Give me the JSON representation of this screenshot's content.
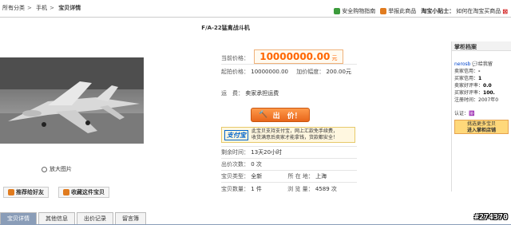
{
  "breadcrumb": [
    "所有分类",
    "手机",
    "宝贝详情"
  ],
  "header": {
    "safety_label": "安全购物指南",
    "report_label": "举报此商品",
    "tip_label": "淘宝小贴士：",
    "tip_link": "如何在淘宝买商品"
  },
  "item": {
    "title": "F/A-22猛禽战斗机",
    "current_price_label": "当前价格：",
    "current_price": "10000000.00",
    "price_unit": "元",
    "start_price_label": "起拍价格：",
    "start_price": "10000000.00",
    "increment_label": "加价幅度：",
    "increment": "200.00元",
    "freight_label": "运　费：",
    "freight_value": "卖家承担运费",
    "bid_button": "出　价！",
    "remaining_label": "剩余时间：",
    "remaining_value": "13天20小时",
    "bid_count_label": "出价次数：",
    "bid_count_value": "0 次",
    "type_label": "宝贝类型：",
    "type_value": "全新",
    "location_label": "所 在 地：",
    "location_value": "上海",
    "quantity_label": "宝贝数量：",
    "quantity_value": "1 件",
    "views_label": "浏 览 量：",
    "views_value": "4589 次"
  },
  "alipay": {
    "logo": "支付宝",
    "text_line1": "此宝贝支持支付宝，网上汇款免手续费，",
    "text_line2": "收货满意后卖家才能拿钱，货款都安全！"
  },
  "gallery": {
    "zoom_label": "放大图片",
    "recommend_label": "推荐给好友",
    "favorite_label": "收藏这件宝贝"
  },
  "seller": {
    "heading": "掌柜档案",
    "name": "nerosb",
    "chat_label": "给我留",
    "seller_credit_label": "卖家信用：",
    "seller_credit_value": "-",
    "buyer_credit_label": "买家信用：",
    "buyer_credit_value": "1",
    "seller_rate_label": "卖家好评率：",
    "seller_rate_value": "0.0",
    "buyer_rate_label": "买家好评率：",
    "buyer_rate_value": "100.",
    "reg_label": "注册时间：",
    "reg_value": "2007年0",
    "verify_label": "认证：",
    "shop_btn_line1": "挑选更多宝贝",
    "shop_btn_line2": "进入掌柜店铺"
  },
  "tabs": [
    "宝贝详情",
    "其他信息",
    "出价记录",
    "留言簿"
  ],
  "watermark": "#274370"
}
